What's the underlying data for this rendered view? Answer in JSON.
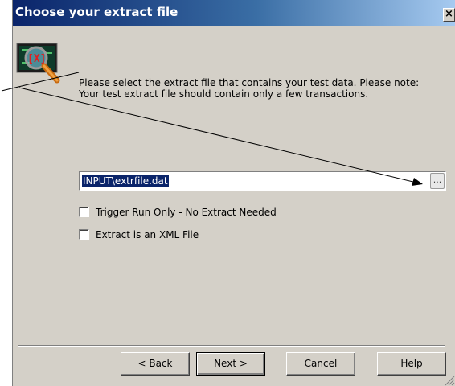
{
  "window": {
    "title": "Choose your extract file",
    "close_symbol": "×"
  },
  "icon": {
    "name": "extract-file-magnifier-icon",
    "glyph": "[X]"
  },
  "instructions": "Please select the extract file that contains your test data.  Please note:  Your test extract file should contain only a few transactions.",
  "file_field": {
    "value": "INPUT\\extrfile.dat",
    "browse_label": "..."
  },
  "options": [
    {
      "label": "Trigger Run Only - No Extract Needed",
      "checked": false
    },
    {
      "label": "Extract is an XML File",
      "checked": false
    }
  ],
  "buttons": {
    "back": "< Back",
    "next": "Next >",
    "cancel": "Cancel",
    "help": "Help"
  },
  "colors": {
    "dialog_bg": "#d4d0c8",
    "title_start": "#0a246a",
    "title_end": "#a6caf0",
    "selection": "#0a246a"
  }
}
